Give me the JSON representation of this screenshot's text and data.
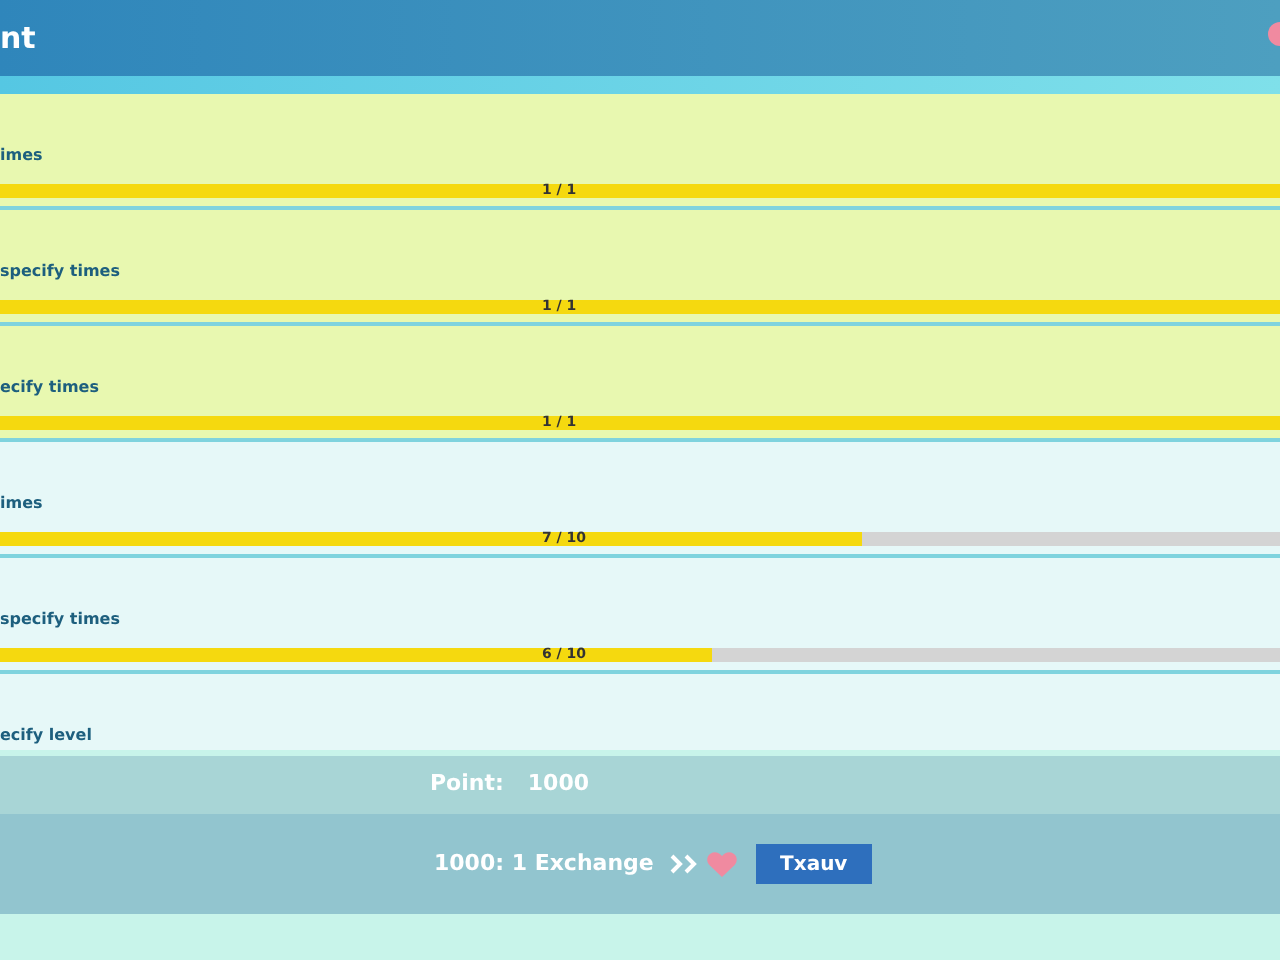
{
  "header": {
    "title": "nt"
  },
  "tasks": [
    {
      "label": "imes",
      "progress": "1 / 1",
      "level": 1,
      "completed": true
    },
    {
      "label": "specify times",
      "progress": "1 / 1",
      "level": 1,
      "completed": true
    },
    {
      "label": "ecify times",
      "progress": "1 / 1",
      "level": 1,
      "completed": true
    },
    {
      "label": "imes",
      "progress": "7 / 10",
      "level": 0.673,
      "completed": false
    },
    {
      "label": "specify times",
      "progress": "6 / 10",
      "level": 0.556,
      "completed": false
    },
    {
      "label": "ecify level",
      "completed": false
    }
  ],
  "points": {
    "label": "Point:",
    "value": "1000"
  },
  "exchange": {
    "rate": "1000: 1 Exchange",
    "button": "Txauv"
  }
}
